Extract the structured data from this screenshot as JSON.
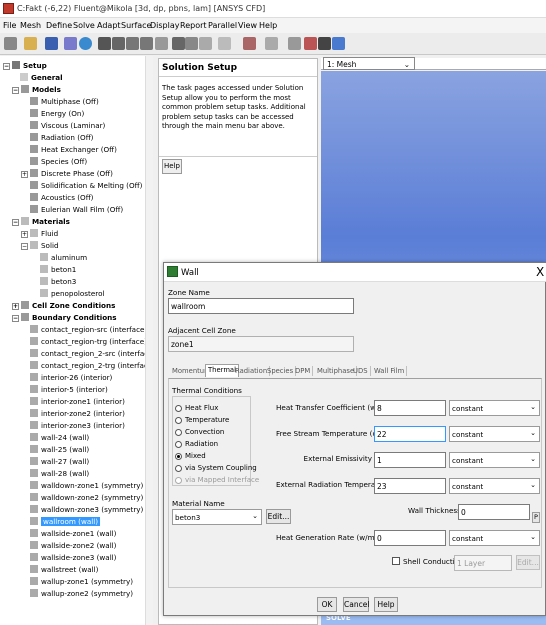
{
  "window_title": "C:Fakt (-6,22) Fluent@Mikola [3d, dp, pbns, lam] [ANSYS CFD]",
  "menu": [
    "File",
    "Mesh",
    "Define",
    "Solve",
    "Adapt",
    "Surface",
    "Display",
    "Report",
    "Parallel",
    "View",
    "Help"
  ],
  "tree": {
    "setup": "Setup",
    "general": "General",
    "models": "Models",
    "model_items": [
      "Multiphase (Off)",
      "Energy (On)",
      "Viscous (Laminar)",
      "Radiation (Off)",
      "Heat Exchanger (Off)",
      "Species (Off)",
      "Discrete Phase (Off)",
      "Solidification & Melting (Off)",
      "Acoustics (Off)",
      "Eulerian Wall Film (Off)"
    ],
    "materials": "Materials",
    "fluid": "Fluid",
    "solid": "Solid",
    "solid_items": [
      "aluminum",
      "beton1",
      "beton3",
      "penopolosterol"
    ],
    "cell_zone": "Cell Zone Conditions",
    "boundary": "Boundary Conditions",
    "boundary_items": [
      "contact_region-src (interface)",
      "contact_region-trg (interface)",
      "contact_region_2-src (interface)",
      "contact_region_2-trg (interface)",
      "interior-26 (interior)",
      "interior-5 (interior)",
      "interior-zone1 (interior)",
      "interior-zone2 (interior)",
      "interior-zone3 (interior)",
      "wall-24 (wall)",
      "wall-25 (wall)",
      "wall-27 (wall)",
      "wall-28 (wall)",
      "walldown-zone1 (symmetry)",
      "walldown-zone2 (symmetry)",
      "walldown-zone3 (symmetry)",
      "wallroom (wall)",
      "wallside-zone1 (wall)",
      "wallside-zone2 (wall)",
      "wallside-zone3 (wall)",
      "wallstreet (wall)",
      "wallup-zone1 (symmetry)",
      "wallup-zone2 (symmetry)"
    ],
    "selected": "wallroom (wall)"
  },
  "task": {
    "title": "Solution Setup",
    "description": "The task pages accessed under Solution Setup allow you to perform the most common problem setup tasks. Additional problem setup tasks can be accessed through the main menu bar above.",
    "help": "Help"
  },
  "graphics": {
    "selector": "1: Mesh",
    "bottom_label": "SOLVE"
  },
  "dialog": {
    "title": "Wall",
    "close": "X",
    "zone_name_label": "Zone Name",
    "zone_name": "wallroom",
    "adjacent_label": "Adjacent Cell Zone",
    "adjacent": "zone1",
    "tabs": [
      "Momentum",
      "Thermal",
      "Radiation",
      "Species",
      "DPM",
      "Multiphase",
      "UDS",
      "Wall Film"
    ],
    "active_tab": "Thermal",
    "thermal_conditions_label": "Thermal Conditions",
    "conditions": [
      "Heat Flux",
      "Temperature",
      "Convection",
      "Radiation",
      "Mixed",
      "via System Coupling",
      "via Mapped Interface"
    ],
    "selected_condition": "Mixed",
    "material_name_label": "Material Name",
    "material": "beton3",
    "edit": "Edit...",
    "htc_label": "Heat Transfer Coefficient (w/m2-k)",
    "htc_value": "8",
    "fst_label": "Free Stream Temperature (c)",
    "fst_value": "22",
    "emis_label": "External Emissivity",
    "emis_value": "1",
    "ert_label": "External Radiation Temperature (c)",
    "ert_value": "23",
    "thick_label": "Wall Thickness (m)",
    "thick_value": "0",
    "p_button": "P",
    "hgr_label": "Heat Generation Rate (w/m3)",
    "hgr_value": "0",
    "method": "constant",
    "shell_label": "Shell Conduction",
    "layer": "1 Layer",
    "edit_small": "Edit...",
    "ok": "OK",
    "cancel": "Cancel",
    "help": "Help"
  }
}
